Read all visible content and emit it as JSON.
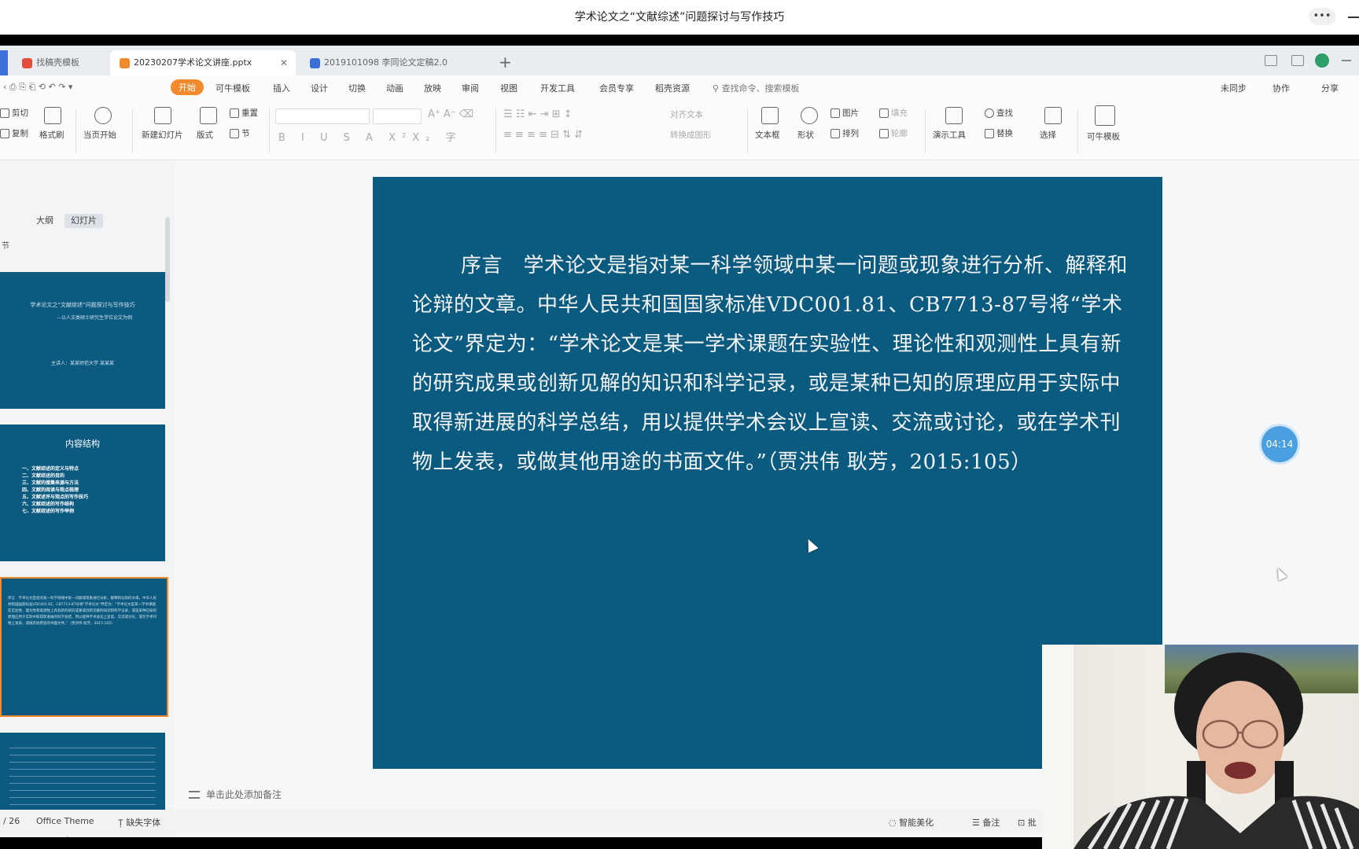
{
  "meeting": {
    "title": "学术论文之“文献综述”问题探讨与写作技巧",
    "more": "•••"
  },
  "tabs": [
    {
      "label": "找稿壳模板",
      "color": "#e44c3c"
    },
    {
      "label": "20230207学术论文讲座.pptx",
      "color": "#f08a2d"
    },
    {
      "label": "2019101098 李同论文定稿2.0",
      "color": "#3d6fd8"
    }
  ],
  "tab_plus": "+",
  "menu": {
    "start": "开始",
    "items": [
      "可牛模板",
      "插入",
      "设计",
      "切换",
      "动画",
      "放映",
      "审阅",
      "视图",
      "开发工具",
      "会员专享",
      "稻壳资源"
    ],
    "search": "查找命令、搜索模板",
    "right": [
      "未同步",
      "协作",
      "分享"
    ]
  },
  "ribbon": {
    "cut": "剪切",
    "copy": "复制",
    "format_painter": "格式刷",
    "play": "当页开始",
    "new_slide": "新建幻灯片",
    "layout": "版式",
    "reset": "重置",
    "section": "节",
    "align_text": "对齐文本",
    "convert_smartart": "转换成图形",
    "textbox": "文本框",
    "shape": "形状",
    "picture": "图片",
    "arrange": "排列",
    "fill": "填充",
    "outline": "轮廓",
    "presenter": "演示工具",
    "find": "查找",
    "replace": "替换",
    "select": "选择",
    "template": "可牛模板"
  },
  "pane": {
    "outline_tab": "大纲",
    "slides_tab": "幻灯片",
    "section": "节",
    "thumb1_title": "学术论文之“文献综述”问题探讨与写作技巧",
    "thumb1_sub": "—以人文类硕士研究生学位论文为例",
    "thumb1_author": "主讲人：某某师范大学 某某某",
    "thumb2_title": "内容结构",
    "thumb2_items": [
      "一、文献综述的定义与特点",
      "二、文献综述的目的",
      "三、文献的搜集来源与方法",
      "四、文献的阅读与观点梳理",
      "五、文献述评与观点的写作技巧",
      "六、文献综述的写作结构",
      "七、文献综述的写作举例"
    ]
  },
  "slide": {
    "text": "序言　学术论文是指对某一科学领域中某一问题或现象进行分析、解释和论辩的文章。中华人民共和国国家标准VDC001.81、CB7713-87号将“学术论文”界定为：“学术论文是某一学术课题在实验性、理论性和观测性上具有新的研究成果或创新见解的知识和科学记录，或是某种已知的原理应用于实际中取得新进展的科学总结，用以提供学术会议上宣读、交流或讨论，或在学术刊物上发表，或做其他用途的书面文件。”（贾洪伟 耿芳，2015:105）"
  },
  "notes_placeholder": "单击此处添加备注",
  "status": {
    "page": "/ 26",
    "theme": "Office Theme",
    "missing_font": "缺失字体",
    "beautify": "智能美化",
    "notes": "备注",
    "comment": "批"
  },
  "timer": "04:14",
  "colors": {
    "slide_bg": "#0b5a7f",
    "accent": "#f08a2d",
    "timer": "#4a9fe0"
  }
}
